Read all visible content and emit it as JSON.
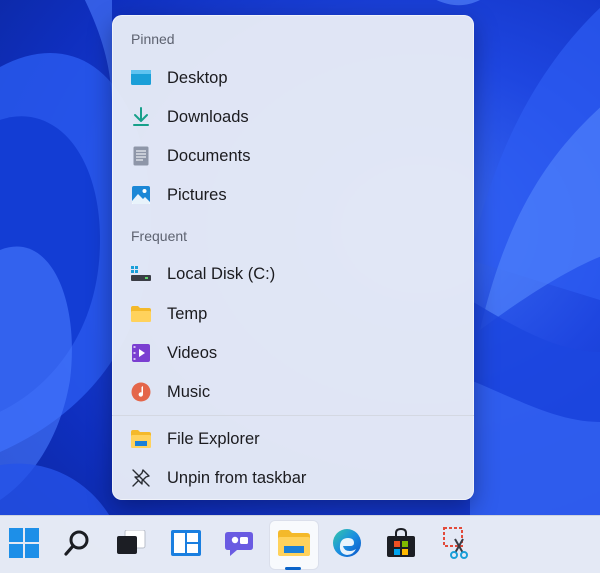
{
  "jumplist": {
    "pinned_header": "Pinned",
    "pinned": [
      {
        "label": "Desktop",
        "icon": "desktop-icon"
      },
      {
        "label": "Downloads",
        "icon": "downloads-icon"
      },
      {
        "label": "Documents",
        "icon": "documents-icon"
      },
      {
        "label": "Pictures",
        "icon": "pictures-icon"
      }
    ],
    "frequent_header": "Frequent",
    "frequent": [
      {
        "label": "Local Disk (C:)",
        "icon": "local-disk-icon"
      },
      {
        "label": "Temp",
        "icon": "folder-icon"
      },
      {
        "label": "Videos",
        "icon": "videos-icon"
      },
      {
        "label": "Music",
        "icon": "music-icon"
      }
    ],
    "actions": [
      {
        "label": "File Explorer",
        "icon": "file-explorer-icon"
      },
      {
        "label": "Unpin from taskbar",
        "icon": "unpin-icon"
      }
    ]
  },
  "taskbar": {
    "items": [
      {
        "name": "start",
        "icon": "windows-logo-icon",
        "active": false
      },
      {
        "name": "search",
        "icon": "search-icon",
        "active": false
      },
      {
        "name": "task-view",
        "icon": "task-view-icon",
        "active": false
      },
      {
        "name": "widgets",
        "icon": "widgets-icon",
        "active": false
      },
      {
        "name": "chat",
        "icon": "chat-icon",
        "active": false
      },
      {
        "name": "file-explorer",
        "icon": "file-explorer-icon",
        "active": true
      },
      {
        "name": "edge",
        "icon": "edge-icon",
        "active": false
      },
      {
        "name": "store",
        "icon": "store-icon",
        "active": false
      },
      {
        "name": "snipping-tool",
        "icon": "snipping-tool-icon",
        "active": false
      }
    ]
  },
  "colors": {
    "accent": "#0a63c9",
    "wallpaper_blue": "#1e46e0"
  }
}
